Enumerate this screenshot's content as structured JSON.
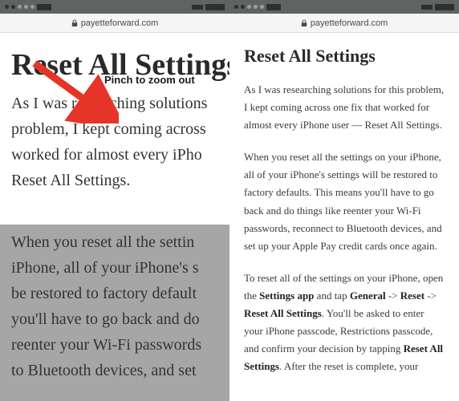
{
  "url": "payetteforward.com",
  "callout": "Pinch to zoom out",
  "left": {
    "heading": "Reset All Settings",
    "para1_lines": [
      "As I was researching solutions",
      "problem, I kept coming across",
      "worked for almost every iPho",
      "Reset All Settings."
    ],
    "para2_lines": [
      "When you reset all the settin",
      "iPhone, all of your iPhone's s",
      "be restored to factory default",
      "you'll have to go back and do",
      "reenter your Wi-Fi passwords",
      "to Bluetooth devices, and set"
    ]
  },
  "right": {
    "heading": "Reset All Settings",
    "para1": "As I was researching solutions for this problem, I kept coming across one fix that worked for almost every iPhone user — Reset All Settings.",
    "para2": "When you reset all the settings on your iPhone, all of your iPhone's settings will be restored to factory defaults. This means you'll have to go back and do things like reenter your Wi-Fi passwords, reconnect to Bluetooth devices, and set up your Apple Pay credit cards once again.",
    "para3_pre": "To reset all of the settings on your iPhone, open the ",
    "bold_settings_app": "Settings app",
    "para3_mid1": " and tap ",
    "bold_general": "General",
    "arrow1": " -> ",
    "bold_reset": "Reset",
    "arrow2": " -> ",
    "bold_reset_all": "Reset All Settings",
    "para3_mid2": ". You'll be asked to enter your iPhone passcode, Restrictions passcode, and confirm your decision by tapping ",
    "bold_reset_all2": "Reset All Settings",
    "para3_end": ". After the reset is complete, your"
  }
}
